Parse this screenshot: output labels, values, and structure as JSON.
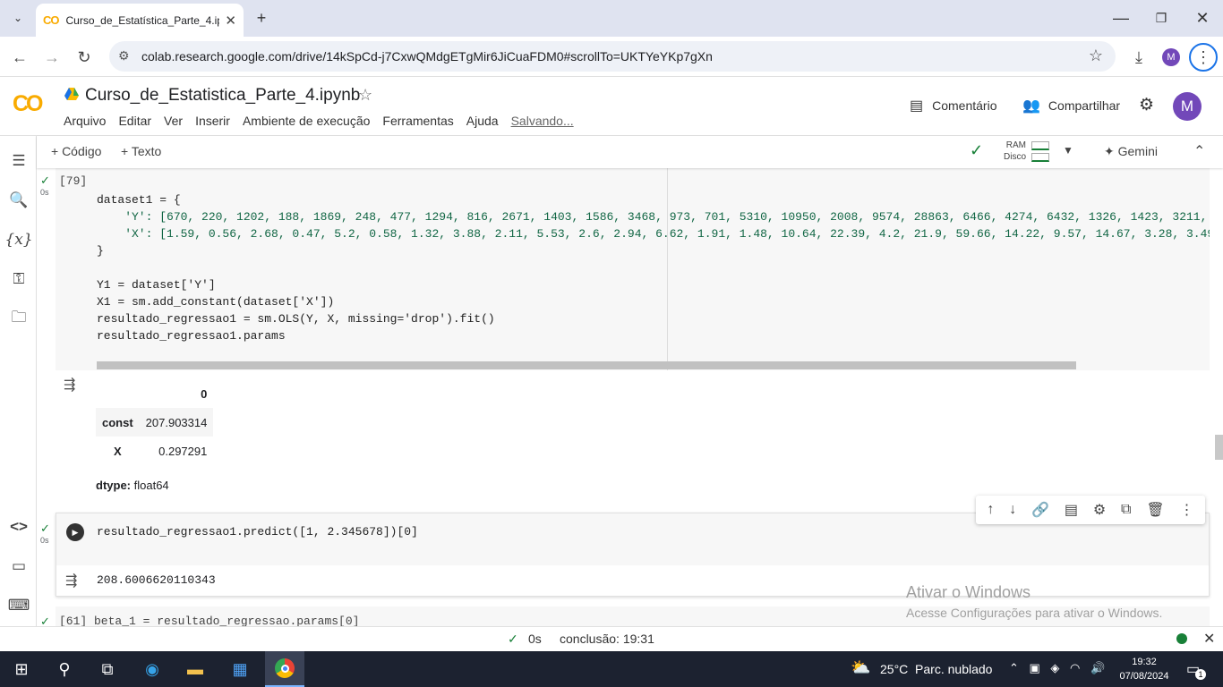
{
  "browser": {
    "tab_title": "Curso_de_Estatística_Parte_4.ipy",
    "tab_icon": "CO",
    "url": "colab.research.google.com/drive/14kSpCd-j7CxwQMdgETgMir6JiCuaFDM0#scrollTo=UKTYeYKp7gXn",
    "profile_initial": "M"
  },
  "colab": {
    "logo": "CO",
    "notebook_title": "Curso_de_Estatistica_Parte_4.ipynb",
    "menu": [
      "Arquivo",
      "Editar",
      "Ver",
      "Inserir",
      "Ambiente de execução",
      "Ferramentas",
      "Ajuda"
    ],
    "saving_status": "Salvando...",
    "comment_label": "Comentário",
    "share_label": "Compartilhar",
    "avatar_initial": "M"
  },
  "toolbar": {
    "add_code": "+ Código",
    "add_text": "+ Texto",
    "ram_label": "RAM",
    "disk_label": "Disco",
    "gemini_label": "Gemini"
  },
  "cell1": {
    "exec_count": "[79]",
    "time": "0s",
    "code_lines": [
      "dataset1 = {",
      "    'Y': [670, 220, 1202, 188, 1869, 248, 477, 1294, 816, 2671, 1403, 1586, 3468, 973, 701, 5310, 10950, 2008, 9574, 28863, 6466, 4274, 6432, 1326, 1423, 3211, 2",
      "    'X': [1.59, 0.56, 2.68, 0.47, 5.2, 0.58, 1.32, 3.88, 2.11, 5.53, 2.6, 2.94, 6.62, 1.91, 1.48, 10.64, 22.39, 4.2, 21.9, 59.66, 14.22, 9.57, 14.67, 3.28, 3.49,",
      "}",
      "",
      "Y1 = dataset['Y']",
      "X1 = sm.add_constant(dataset['X'])",
      "resultado_regressao1 = sm.OLS(Y, X, missing='drop').fit()",
      "resultado_regressao1.params"
    ],
    "output": {
      "header": "0",
      "rows": [
        {
          "label": "const",
          "value": "207.903314"
        },
        {
          "label": "X",
          "value": "0.297291"
        }
      ],
      "dtype_label": "dtype:",
      "dtype_value": "float64"
    }
  },
  "cell2": {
    "time": "0s",
    "code": "resultado_regressao1.predict([1, 2.345678])[0]",
    "output": "208.6006620110343"
  },
  "cell3": {
    "code": "[61] beta_1 = resultado_regressao.params[0]"
  },
  "watermark": {
    "title": "Ativar o Windows",
    "subtitle": "Acesse Configurações para ativar o Windows."
  },
  "statusbar": {
    "time": "0s",
    "completion": "conclusão: 19:31"
  },
  "taskbar": {
    "weather": "25°C  Parc. nublado",
    "clock_time": "19:32",
    "clock_date": "07/08/2024",
    "notif_count": "1"
  }
}
